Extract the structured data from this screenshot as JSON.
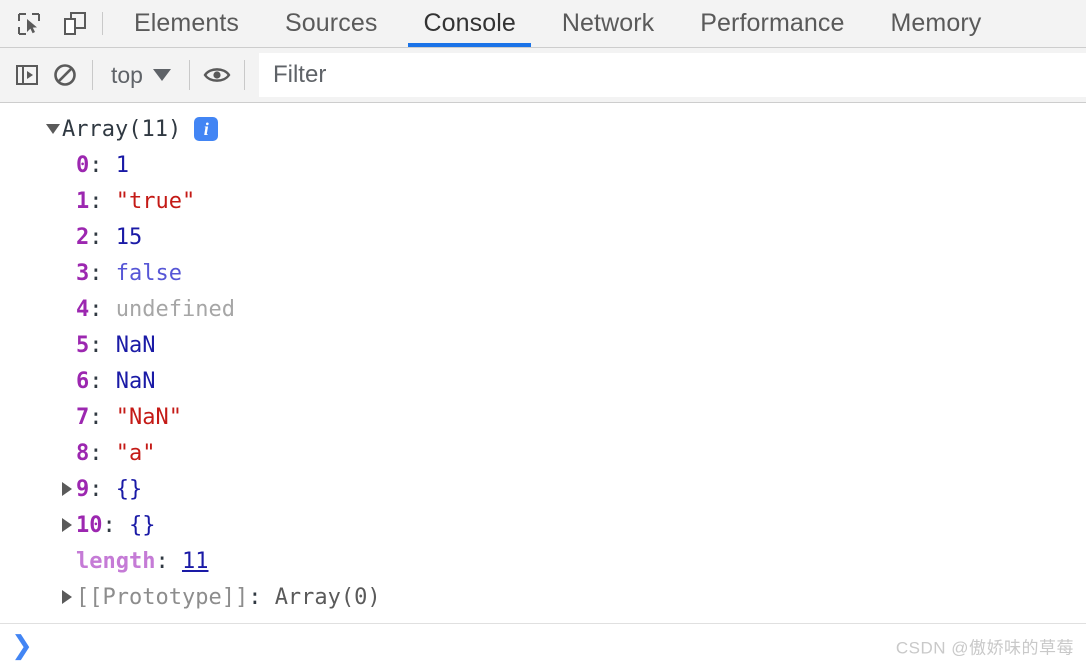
{
  "tabbar": {
    "icons": [
      {
        "name": "inspect-element-icon",
        "label": "Inspect element"
      },
      {
        "name": "device-toolbar-icon",
        "label": "Toggle device toolbar"
      }
    ],
    "tabs": [
      {
        "label": "Elements",
        "active": false
      },
      {
        "label": "Sources",
        "active": false
      },
      {
        "label": "Console",
        "active": true
      },
      {
        "label": "Network",
        "active": false
      },
      {
        "label": "Performance",
        "active": false
      },
      {
        "label": "Memory",
        "active": false
      }
    ]
  },
  "console_toolbar": {
    "sidebar_toggle_label": "Show console sidebar",
    "clear_label": "Clear console",
    "context_value": "top",
    "eye_label": "Create live expression",
    "filter_placeholder": "Filter",
    "filter_value": ""
  },
  "console_output": {
    "header": {
      "label": "Array(11)",
      "expanded": true,
      "info_badge": "i"
    },
    "properties": [
      {
        "key": "0",
        "value": "1",
        "type": "number",
        "expandable": false
      },
      {
        "key": "1",
        "value": "\"true\"",
        "type": "string",
        "expandable": false
      },
      {
        "key": "2",
        "value": "15",
        "type": "number",
        "expandable": false
      },
      {
        "key": "3",
        "value": "false",
        "type": "boolean",
        "expandable": false
      },
      {
        "key": "4",
        "value": "undefined",
        "type": "undefined",
        "expandable": false
      },
      {
        "key": "5",
        "value": "NaN",
        "type": "number",
        "expandable": false
      },
      {
        "key": "6",
        "value": "NaN",
        "type": "number",
        "expandable": false
      },
      {
        "key": "7",
        "value": "\"NaN\"",
        "type": "string",
        "expandable": false
      },
      {
        "key": "8",
        "value": "\"a\"",
        "type": "string",
        "expandable": false
      },
      {
        "key": "9",
        "value": "{}",
        "type": "object",
        "expandable": true
      },
      {
        "key": "10",
        "value": "{}",
        "type": "object",
        "expandable": true
      }
    ],
    "length_row": {
      "key": "length",
      "value": "11",
      "type": "number"
    },
    "prototype_row": {
      "key": "[[Prototype]]",
      "value": "Array(0)",
      "expandable": true
    }
  },
  "prompt": {
    "arrow": "❯",
    "input_value": ""
  },
  "watermark": {
    "text": "CSDN @傲娇味的草莓"
  },
  "colors": {
    "accent": "#1a73e8",
    "toolbar_bg": "#f3f3f3",
    "key": "#9c27b0",
    "string": "#c41a16",
    "number": "#1a1aa6",
    "boolean": "#5656d6",
    "undefined": "#a6a6a6",
    "info_badge": "#4285f4"
  }
}
